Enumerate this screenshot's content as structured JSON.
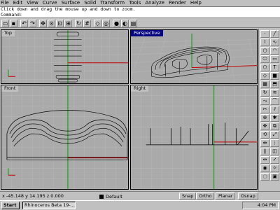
{
  "menubar": {
    "items": [
      "File",
      "Edit",
      "View",
      "Curve",
      "Surface",
      "Solid",
      "Transform",
      "Tools",
      "Analyze",
      "Render",
      "Help"
    ]
  },
  "command": {
    "prompt_line": "Click down and drag the mouse up and down to zoom.",
    "command_label": "Command:"
  },
  "toolbar": {
    "icons": [
      "new-file-icon",
      "save-icon",
      "undo-icon",
      "redo-icon",
      "pan-icon",
      "zoom-icon",
      "zoom-window-icon",
      "zoom-extents-icon",
      "rotate-view-icon",
      "grid-icon",
      "snap-icon",
      "osnap-icon",
      "shade-icon",
      "properties-icon",
      "layer-icon"
    ]
  },
  "viewports": {
    "top": {
      "title": "Top"
    },
    "perspective": {
      "title": "Perspective",
      "active": true
    },
    "front": {
      "title": "Front"
    },
    "right": {
      "title": "Right"
    }
  },
  "statusbar": {
    "coords": "x -45.148   y 14.195   z 0.000",
    "layer": "Default",
    "buttons": [
      "Snap",
      "Ortho",
      "Planar",
      "Osnap"
    ]
  },
  "taskbar": {
    "start_label": "Start",
    "task_label": "Rhinoceros Beta 19-...",
    "clock": "4:04 PM"
  },
  "colors": {
    "viewport_bg": "#aaaaaa",
    "grid": "#b8b8b8",
    "axis_x": "#c00000",
    "axis_y": "#00a000",
    "active_title": "#000080"
  }
}
